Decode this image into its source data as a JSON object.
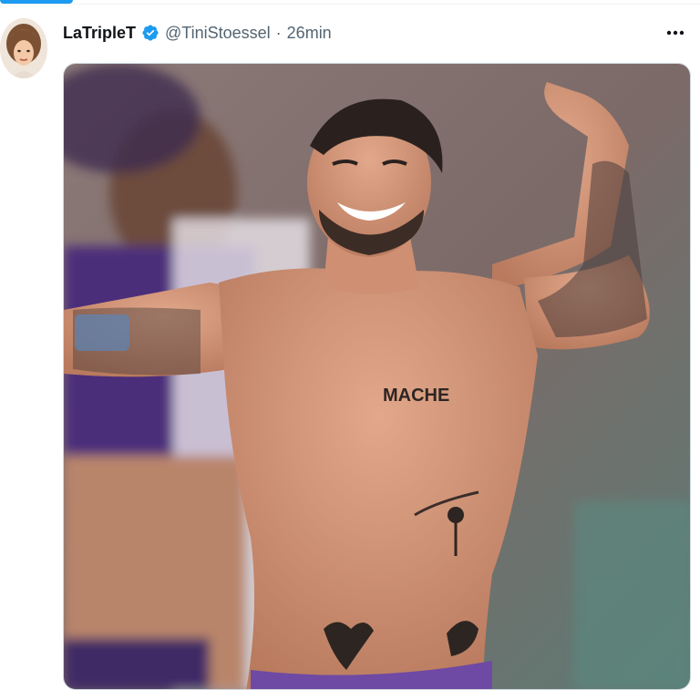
{
  "tweet": {
    "display_name": "LaTripleT",
    "handle": "@TiniStoessel",
    "separator": "·",
    "time": "26min",
    "verified": true,
    "more_icon": "more-horizontal-icon"
  },
  "media": {
    "type": "photo",
    "tattoo_text": "MACHE"
  },
  "colors": {
    "accent": "#1d9bf0",
    "text_primary": "#0f1419",
    "text_secondary": "#536471"
  }
}
